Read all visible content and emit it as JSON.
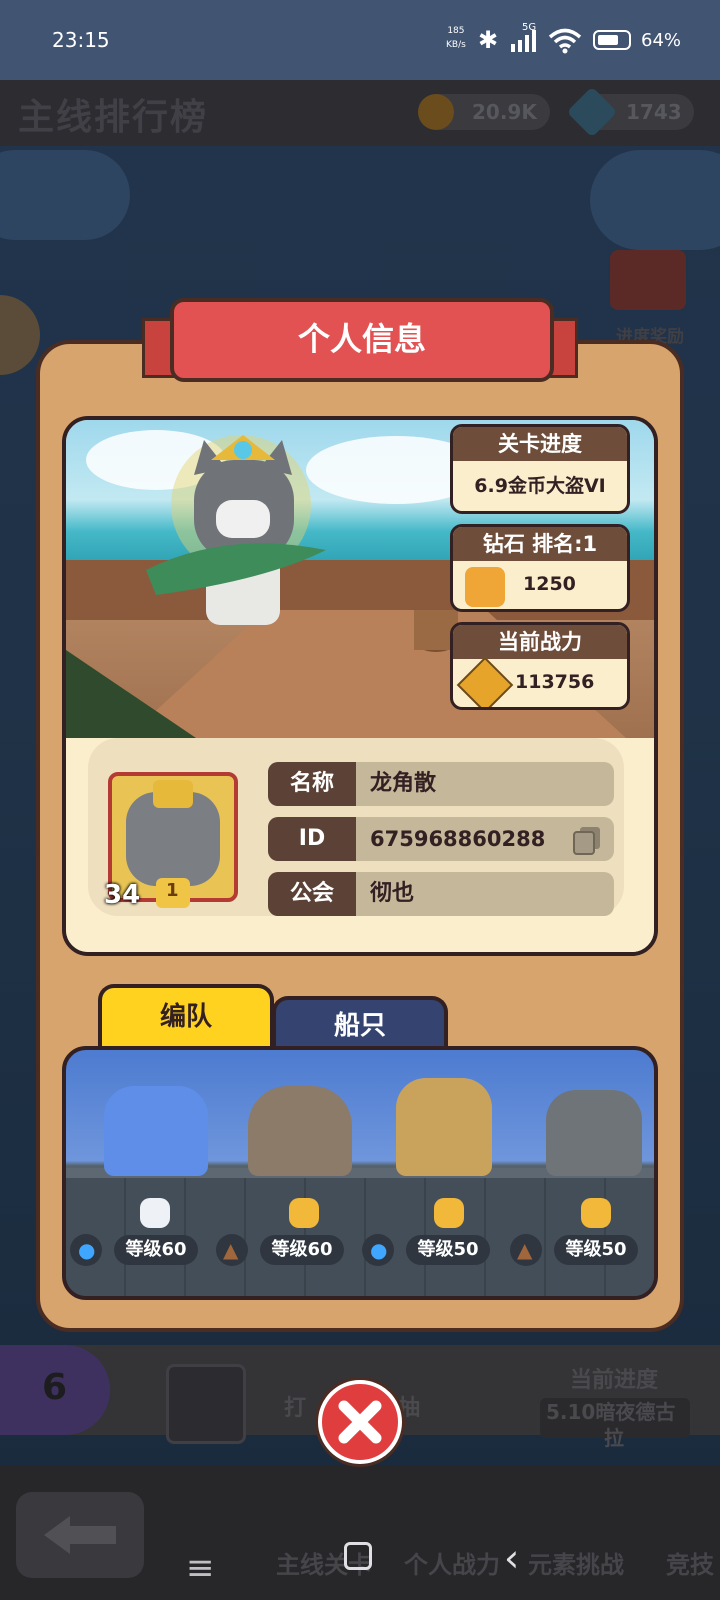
{
  "status_bar": {
    "time": "23:15",
    "net_speed_value": "185",
    "net_speed_unit": "KB/s",
    "network": "5G",
    "battery": "64%"
  },
  "header": {
    "title": "主线排行榜",
    "coins": "20.9K",
    "gems": "1743"
  },
  "side": {
    "progress_reward": "进度奖励"
  },
  "dialog": {
    "title": "个人信息",
    "stats": [
      {
        "header": "关卡进度",
        "value": "6.9金币大盗VI"
      },
      {
        "header": "钻石  排名:1",
        "value": "1250"
      },
      {
        "header": "当前战力",
        "value": "113756"
      }
    ],
    "profile": {
      "avatar_level": "34",
      "trophy_rank": "1",
      "name_label": "名称",
      "name_value": "龙角散",
      "id_label": "ID",
      "id_value": "675968860288",
      "guild_label": "公会",
      "guild_value": "彻也"
    },
    "tabs": [
      {
        "label": "编队",
        "active": true
      },
      {
        "label": "船只",
        "active": false
      }
    ],
    "team": [
      {
        "level": "等级60",
        "element": "water",
        "paw": "white"
      },
      {
        "level": "等级60",
        "element": "earth",
        "paw": "gold"
      },
      {
        "level": "等级50",
        "element": "water",
        "paw": "gold"
      },
      {
        "level": "等级50",
        "element": "earth",
        "paw": "gold"
      }
    ]
  },
  "background_list": {
    "rank": "6",
    "name_partial_left": "打",
    "name_partial_right": "抽",
    "progress_label": "当前进度",
    "progress_value_line1": "5.10暗夜德古",
    "progress_value_line2": "拉"
  },
  "bottom_nav": [
    {
      "label": "主线关卡"
    },
    {
      "label": "个人战力"
    },
    {
      "label": "元素挑战"
    },
    {
      "label": "竞技"
    }
  ],
  "colors": {
    "ribbon": "#e25253",
    "panel": "#d7a46d",
    "tab_active": "#ffd21f",
    "tab_inactive": "#34436f",
    "close": "#e03d3f"
  }
}
